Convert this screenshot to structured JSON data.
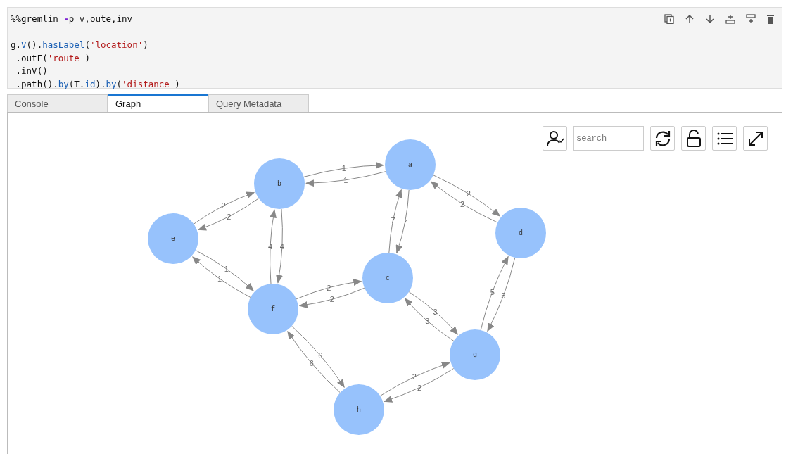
{
  "code_cell": {
    "magic": [
      {
        "text": "%%gremlin ",
        "kind": "plain"
      },
      {
        "text": "-",
        "kind": "operator"
      },
      {
        "text": "p v,oute,inv",
        "kind": "plain"
      }
    ],
    "query": [
      [
        {
          "text": "g.",
          "kind": "plain"
        },
        {
          "text": "V",
          "kind": "function"
        },
        {
          "text": "().",
          "kind": "plain"
        },
        {
          "text": "hasLabel",
          "kind": "function"
        },
        {
          "text": "(",
          "kind": "plain"
        },
        {
          "text": "'location'",
          "kind": "string"
        },
        {
          "text": ")",
          "kind": "plain"
        }
      ],
      [
        {
          "text": " .outE(",
          "kind": "plain"
        },
        {
          "text": "'route'",
          "kind": "string"
        },
        {
          "text": ")",
          "kind": "plain"
        }
      ],
      [
        {
          "text": " .inV()",
          "kind": "plain"
        }
      ],
      [
        {
          "text": " .path().",
          "kind": "plain"
        },
        {
          "text": "by",
          "kind": "function"
        },
        {
          "text": "(T.",
          "kind": "plain"
        },
        {
          "text": "id",
          "kind": "function"
        },
        {
          "text": ").",
          "kind": "plain"
        },
        {
          "text": "by",
          "kind": "function"
        },
        {
          "text": "(",
          "kind": "plain"
        },
        {
          "text": "'distance'",
          "kind": "string"
        },
        {
          "text": ")",
          "kind": "plain"
        }
      ]
    ]
  },
  "tabs": [
    {
      "label": "Console",
      "selected": false
    },
    {
      "label": "Graph",
      "selected": true
    },
    {
      "label": "Query Metadata",
      "selected": false
    }
  ],
  "graph": {
    "search": {
      "placeholder": "search"
    },
    "nodes": [
      {
        "label": "a"
      },
      {
        "label": "b"
      },
      {
        "label": "c"
      },
      {
        "label": "d"
      },
      {
        "label": "e"
      },
      {
        "label": "f"
      },
      {
        "label": "g"
      },
      {
        "label": "h"
      }
    ],
    "edges": [
      {
        "label": "1"
      },
      {
        "label": "1"
      },
      {
        "label": "7"
      },
      {
        "label": "7"
      },
      {
        "label": "2"
      },
      {
        "label": "2"
      },
      {
        "label": "2"
      },
      {
        "label": "2"
      },
      {
        "label": "4"
      },
      {
        "label": "4"
      },
      {
        "label": "1"
      },
      {
        "label": "1"
      },
      {
        "label": "2"
      },
      {
        "label": "2"
      },
      {
        "label": "3"
      },
      {
        "label": "3"
      },
      {
        "label": "5"
      },
      {
        "label": "5"
      },
      {
        "label": "6"
      },
      {
        "label": "6"
      },
      {
        "label": "2"
      },
      {
        "label": "2"
      }
    ]
  }
}
